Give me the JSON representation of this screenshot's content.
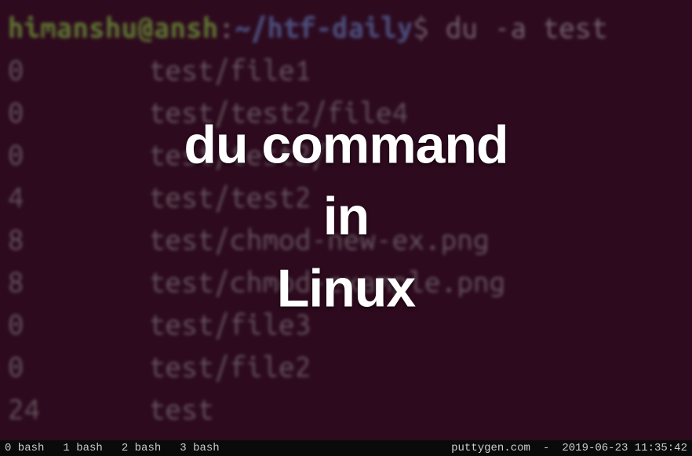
{
  "prompt": {
    "user_host": "himanshu@ansh",
    "colon": ":",
    "path": "~/htf-daily",
    "dollar": "$",
    "command": "du -a test"
  },
  "output": [
    {
      "size": "0",
      "path": "test/file1"
    },
    {
      "size": "0",
      "path": "test/test2/file4"
    },
    {
      "size": "0",
      "path": "test/test2/"
    },
    {
      "size": "4",
      "path": "test/test2"
    },
    {
      "size": "8",
      "path": "test/chmod-new-ex.png"
    },
    {
      "size": "8",
      "path": "test/chmod-example.png"
    },
    {
      "size": "0",
      "path": "test/file3"
    },
    {
      "size": "0",
      "path": "test/file2"
    },
    {
      "size": "24",
      "path": "test"
    }
  ],
  "title": {
    "line1": "du command",
    "line2": "in",
    "line3": "Linux"
  },
  "status": {
    "tabs": [
      {
        "index": "0",
        "name": "bash"
      },
      {
        "index": "1",
        "name": "bash"
      },
      {
        "index": "2",
        "name": "bash"
      },
      {
        "index": "3",
        "name": "bash"
      }
    ],
    "site": "puttygen.com",
    "sep": "-",
    "timestamp": "2019-06-23 11:35:42"
  }
}
